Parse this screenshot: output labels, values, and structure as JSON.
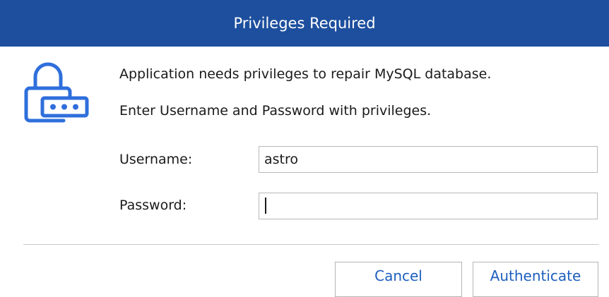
{
  "dialog": {
    "title": "Privileges Required",
    "message": "Application needs privileges to repair MySQL database.",
    "instruction": "Enter Username and Password with privileges.",
    "lock_icon": "lock-password-icon",
    "accent_color": "#1d4f9e"
  },
  "form": {
    "username_label": "Username:",
    "username_value": "astro",
    "password_label": "Password:",
    "password_value": ""
  },
  "buttons": {
    "cancel_label": "Cancel",
    "authenticate_label": "Authenticate"
  }
}
